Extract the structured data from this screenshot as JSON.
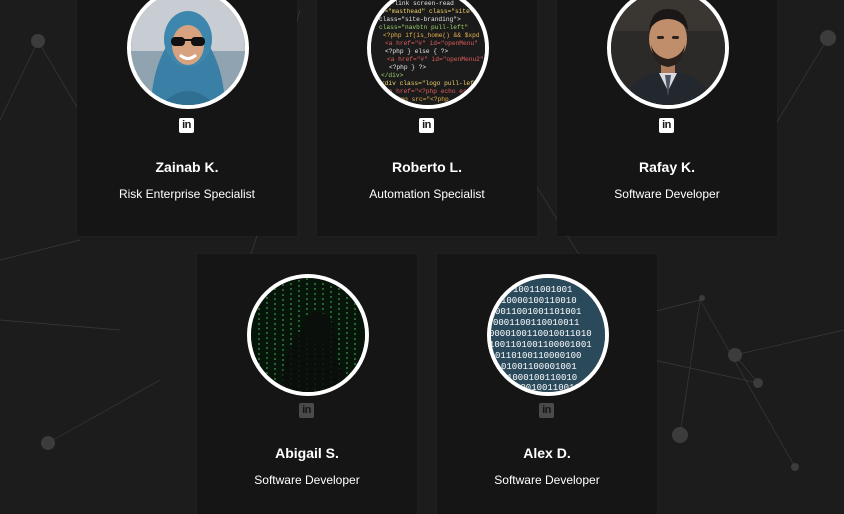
{
  "team": {
    "members": [
      {
        "name": "Zainab K.",
        "role": "Risk Enterprise Specialist",
        "social": "linkedin-icon"
      },
      {
        "name": "Roberto L.",
        "role": "Automation Specialist",
        "social": "linkedin-icon"
      },
      {
        "name": "Rafay K.",
        "role": "Software Developer",
        "social": "linkedin-icon"
      },
      {
        "name": "Abigail S.",
        "role": "Software Developer",
        "social": "linkedin-icon"
      },
      {
        "name": "Alex D.",
        "role": "Software Developer",
        "social": "linkedin-icon"
      }
    ],
    "linkedin_glyph": "in"
  },
  "photos": {
    "roberto_code": [
      "p-link screen-read",
      "id=\"masthead\" class=\"site-he",
      "class=\"site-branding\">",
      "class=\"navbtn pull-left\"",
      "<?php if(is_home() && $xpd",
      "<a href=\"#\" id=\"openMenu\"",
      "<?php } else { ?>",
      "<a href=\"#\" id=\"openMenu2\"",
      "<?php } ?>",
      "</div>",
      "<div class=\"logo pull-left\"",
      "<a href=\"<?php echo esc",
      "<img src=\"<?php"
    ],
    "alex_binary": [
      "10011001001",
      "10000100110010",
      "0011001001101001",
      "0001100110010011",
      "0000100110010011010",
      "1001101001100001001",
      "0110100110000100",
      "01001100001001",
      "1000100110010",
      "0001001100100"
    ]
  },
  "colors": {
    "background": "#1c1c1c",
    "card": "#151515",
    "text": "#ffffff",
    "avatar_border": "#ffffff",
    "icon_bright": "#ffffff",
    "icon_dim": "#4a4a4a"
  }
}
